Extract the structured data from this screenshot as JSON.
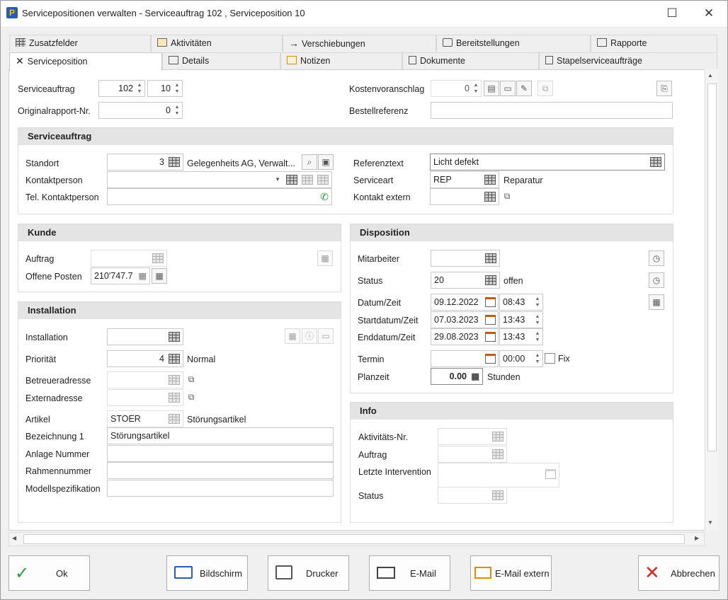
{
  "window": {
    "title": "Servicepositionen verwalten - Serviceauftrag 102 , Serviceposition 10",
    "min": "—",
    "max": "☐",
    "close": "✕"
  },
  "tabs_row1": [
    "Zusatzfelder",
    "Aktivitäten",
    "Verschiebungen",
    "Bereitstellungen",
    "Rapporte"
  ],
  "tabs_row2": [
    "Serviceposition",
    "Details",
    "Notizen",
    "Dokumente",
    "Stapelserviceaufträge"
  ],
  "top": {
    "serviceauftrag_label": "Serviceauftrag",
    "serviceauftrag_value": "102",
    "position_value": "10",
    "originalrapport_label": "Originalrapport-Nr.",
    "originalrapport_value": "0",
    "kostenvoranschlag_label": "Kostenvoranschlag",
    "kostenvoranschlag_value": "0",
    "bestellreferenz_label": "Bestellreferenz",
    "bestellreferenz_value": ""
  },
  "serviceauftrag": {
    "heading": "Serviceauftrag",
    "standort_label": "Standort",
    "standort_value": "3",
    "standort_name": "Gelegenheits AG, Verwalt...",
    "kontaktperson_label": "Kontaktperson",
    "tel_label": "Tel. Kontaktperson",
    "referenztext_label": "Referenztext",
    "referenztext_value": "Licht defekt",
    "serviceart_label": "Serviceart",
    "serviceart_value": "REP",
    "serviceart_name": "Reparatur",
    "kontakt_extern_label": "Kontakt extern"
  },
  "kunde": {
    "heading": "Kunde",
    "auftrag_label": "Auftrag",
    "offene_posten_label": "Offene Posten",
    "offene_posten_value": "210'747.7"
  },
  "installation": {
    "heading": "Installation",
    "installation_label": "Installation",
    "prioritaet_label": "Priorität",
    "prioritaet_value": "4",
    "prioritaet_name": "Normal",
    "betreuer_label": "Betreueradresse",
    "extern_label": "Externadresse",
    "artikel_label": "Artikel",
    "artikel_value": "STOER",
    "artikel_name": "Störungsartikel",
    "bez1_label": "Bezeichnung 1",
    "bez1_value": "Störungsartikel",
    "anlage_label": "Anlage Nummer",
    "rahmen_label": "Rahmennummer",
    "modell_label": "Modellspezifikation"
  },
  "disposition": {
    "heading": "Disposition",
    "mitarbeiter_label": "Mitarbeiter",
    "status_label": "Status",
    "status_value": "20",
    "status_name": "offen",
    "datum_label": "Datum/Zeit",
    "datum_value": "09.12.2022",
    "datum_time": "08:43",
    "start_label": "Startdatum/Zeit",
    "start_value": "07.03.2023",
    "start_time": "13:43",
    "end_label": "Enddatum/Zeit",
    "end_value": "29.08.2023",
    "end_time": "13:43",
    "termin_label": "Termin",
    "termin_time": "00:00",
    "fix_label": "Fix",
    "planzeit_label": "Planzeit",
    "planzeit_value": "0.00",
    "planzeit_unit": "Stunden"
  },
  "info": {
    "heading": "Info",
    "aktnr_label": "Aktivitäts-Nr.",
    "auftrag_label": "Auftrag",
    "letzte_label": "Letzte Intervention",
    "status_label": "Status"
  },
  "buttons": {
    "ok": "Ok",
    "bildschirm": "Bildschirm",
    "drucker": "Drucker",
    "email": "E-Mail",
    "email_extern": "E-Mail extern",
    "abbrechen": "Abbrechen"
  },
  "colors": {
    "accent": "#2a5db0",
    "ok_green": "#2e9a3c",
    "cancel_red": "#d42a2a",
    "calendar_orange": "#c95a00"
  }
}
